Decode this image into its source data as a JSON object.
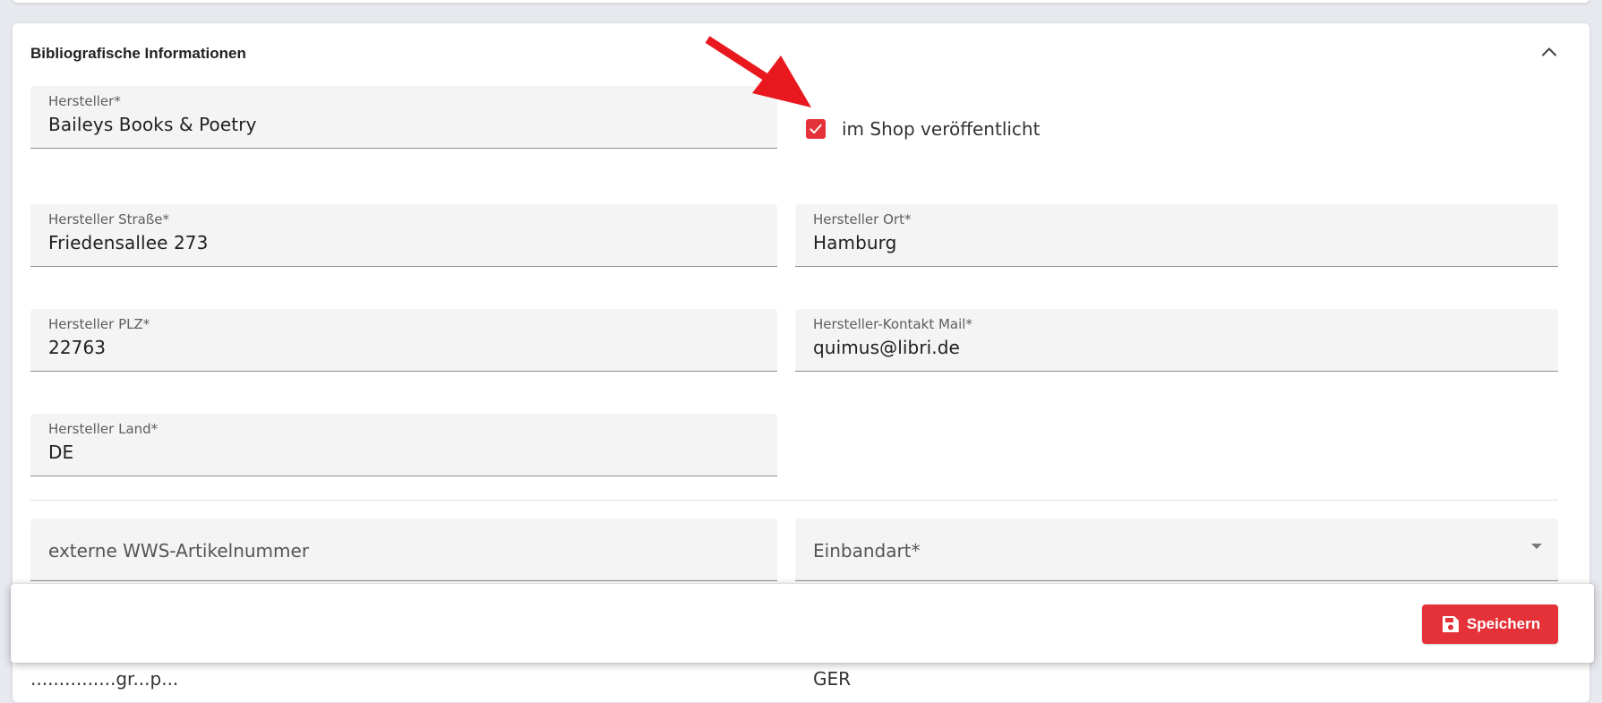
{
  "colors": {
    "accent": "#e53238",
    "field_background": "#f4f4f4",
    "page_background": "#e7e9ee"
  },
  "card": {
    "title": "Bibliografische Informationen",
    "collapse_icon": "chevron-up-icon"
  },
  "checkbox": {
    "label": "im Shop veröffentlicht",
    "checked": true
  },
  "fields": {
    "hersteller": {
      "label": "Hersteller*",
      "value": "Baileys Books & Poetry"
    },
    "strasse": {
      "label": "Hersteller Straße*",
      "value": "Friedensallee 273"
    },
    "ort": {
      "label": "Hersteller Ort*",
      "value": "Hamburg"
    },
    "plz": {
      "label": "Hersteller PLZ*",
      "value": "22763"
    },
    "kontakt_mail": {
      "label": "Hersteller-Kontakt Mail*",
      "value": "quimus@libri.de"
    },
    "land": {
      "label": "Hersteller Land*",
      "value": "DE"
    },
    "wws_artikelnummer": {
      "placeholder": "externe WWS-Artikelnummer"
    },
    "einbandart": {
      "placeholder": "Einbandart*"
    }
  },
  "partial_row": {
    "left_text": "...............gr...p...",
    "right_text": "GER"
  },
  "save_bar": {
    "save_label": "Speichern",
    "save_icon": "floppy-disk-icon"
  }
}
